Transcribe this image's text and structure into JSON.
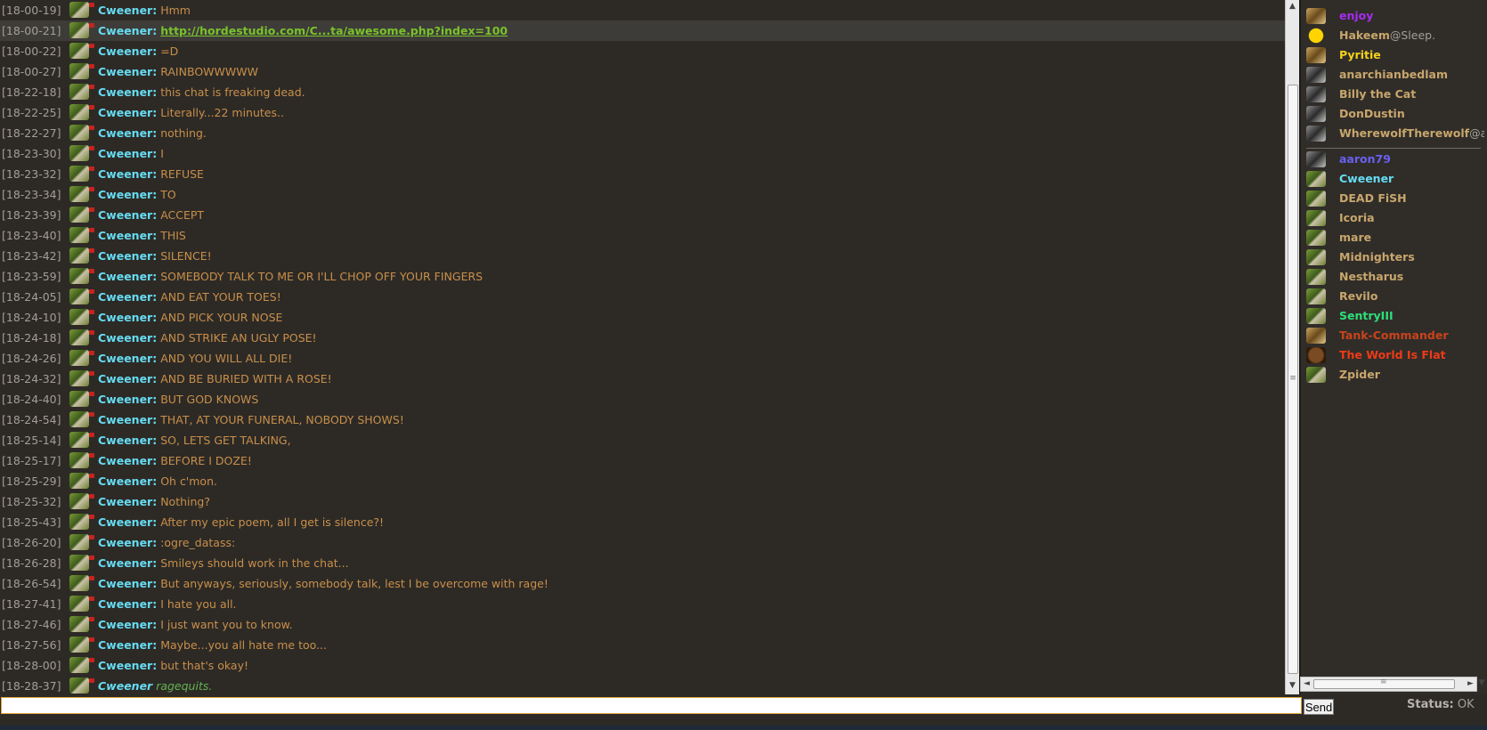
{
  "messages": [
    {
      "time": "[18-00-19]",
      "nick": "Cweener:",
      "text": "Hmm"
    },
    {
      "time": "[18-00-21]",
      "nick": "Cweener:",
      "link": "http://hordestudio.com/C...ta/awesome.php?index=100",
      "highlight": true
    },
    {
      "time": "[18-00-22]",
      "nick": "Cweener:",
      "text": "=D"
    },
    {
      "time": "[18-00-27]",
      "nick": "Cweener:",
      "text": "RAINBOWWWWW"
    },
    {
      "time": "[18-22-18]",
      "nick": "Cweener:",
      "text": "this chat is freaking dead."
    },
    {
      "time": "[18-22-25]",
      "nick": "Cweener:",
      "text": "Literally...22 minutes.."
    },
    {
      "time": "[18-22-27]",
      "nick": "Cweener:",
      "text": "nothing."
    },
    {
      "time": "[18-23-30]",
      "nick": "Cweener:",
      "text": "I"
    },
    {
      "time": "[18-23-32]",
      "nick": "Cweener:",
      "text": "REFUSE"
    },
    {
      "time": "[18-23-34]",
      "nick": "Cweener:",
      "text": "TO"
    },
    {
      "time": "[18-23-39]",
      "nick": "Cweener:",
      "text": "ACCEPT"
    },
    {
      "time": "[18-23-40]",
      "nick": "Cweener:",
      "text": "THIS"
    },
    {
      "time": "[18-23-42]",
      "nick": "Cweener:",
      "text": "SILENCE!"
    },
    {
      "time": "[18-23-59]",
      "nick": "Cweener:",
      "text": "SOMEBODY TALK TO ME OR I'LL CHOP OFF YOUR FINGERS"
    },
    {
      "time": "[18-24-05]",
      "nick": "Cweener:",
      "text": "AND EAT YOUR TOES!"
    },
    {
      "time": "[18-24-10]",
      "nick": "Cweener:",
      "text": "AND PICK YOUR NOSE"
    },
    {
      "time": "[18-24-18]",
      "nick": "Cweener:",
      "text": "AND STRIKE AN UGLY POSE!"
    },
    {
      "time": "[18-24-26]",
      "nick": "Cweener:",
      "text": "AND YOU WILL ALL DIE!"
    },
    {
      "time": "[18-24-32]",
      "nick": "Cweener:",
      "text": "AND BE BURIED WITH A ROSE!"
    },
    {
      "time": "[18-24-40]",
      "nick": "Cweener:",
      "text": "BUT GOD KNOWS"
    },
    {
      "time": "[18-24-54]",
      "nick": "Cweener:",
      "text": "THAT, AT YOUR FUNERAL, NOBODY SHOWS!"
    },
    {
      "time": "[18-25-14]",
      "nick": "Cweener:",
      "text": "SO, LETS GET TALKING,"
    },
    {
      "time": "[18-25-17]",
      "nick": "Cweener:",
      "text": "BEFORE I DOZE!"
    },
    {
      "time": "[18-25-29]",
      "nick": "Cweener:",
      "text": "Oh c'mon."
    },
    {
      "time": "[18-25-32]",
      "nick": "Cweener:",
      "text": "Nothing?"
    },
    {
      "time": "[18-25-43]",
      "nick": "Cweener:",
      "text": "After my epic poem, all I get is silence?!"
    },
    {
      "time": "[18-26-20]",
      "nick": "Cweener:",
      "text": ":ogre_datass:"
    },
    {
      "time": "[18-26-28]",
      "nick": "Cweener:",
      "text": "Smileys should work in the chat..."
    },
    {
      "time": "[18-26-54]",
      "nick": "Cweener:",
      "text": "But anyways, seriously, somebody talk, lest I be overcome with rage!"
    },
    {
      "time": "[18-27-41]",
      "nick": "Cweener:",
      "text": "I hate you all."
    },
    {
      "time": "[18-27-46]",
      "nick": "Cweener:",
      "text": "I just want you to know."
    },
    {
      "time": "[18-27-56]",
      "nick": "Cweener:",
      "text": "Maybe...you all hate me too..."
    },
    {
      "time": "[18-28-00]",
      "nick": "Cweener:",
      "text": "but that's okay!"
    },
    {
      "time": "[18-28-37]",
      "nick": "Cweener",
      "emote": "ragequits."
    }
  ],
  "users_top": [
    {
      "name": "enjoy",
      "color": "#a62cf0",
      "avatar": "gold"
    },
    {
      "name": "Hakeem",
      "suffix": "@Sleep.",
      "color": "#c8a66c",
      "avatar": "smile"
    },
    {
      "name": "Pyritie",
      "color": "#f2d21a",
      "avatar": "gold"
    },
    {
      "name": "anarchianbedlam",
      "color": "#c8a66c",
      "avatar": "alt"
    },
    {
      "name": "Billy the Cat",
      "color": "#c8a66c",
      "avatar": "alt"
    },
    {
      "name": "DonDustin",
      "color": "#c8a66c",
      "avatar": "alt"
    },
    {
      "name": "WherewolfTherewolf",
      "suffix": "@a",
      "color": "#c8a66c",
      "avatar": "alt"
    }
  ],
  "users_bottom": [
    {
      "name": "aaron79",
      "color": "#6a60f0",
      "avatar": "alt"
    },
    {
      "name": "Cweener",
      "color": "#66dcf2",
      "avatar": "orc"
    },
    {
      "name": "DEAD FiSH",
      "color": "#c8a66c",
      "avatar": "orc"
    },
    {
      "name": "Icoria",
      "color": "#c8a66c",
      "avatar": "orc"
    },
    {
      "name": "mare",
      "color": "#c8a66c",
      "avatar": "orc"
    },
    {
      "name": "Midnighters",
      "color": "#c8a66c",
      "avatar": "orc"
    },
    {
      "name": "Nestharus",
      "color": "#c8a66c",
      "avatar": "orc"
    },
    {
      "name": "Revilo",
      "color": "#c8a66c",
      "avatar": "orc"
    },
    {
      "name": "SentryIII",
      "color": "#2ee07a",
      "avatar": "orc"
    },
    {
      "name": "Tank-Commander",
      "color": "#c9431a",
      "avatar": "gold"
    },
    {
      "name": "The World Is Flat",
      "color": "#ef3a17",
      "avatar": "brown"
    },
    {
      "name": "Zpider",
      "color": "#c8a66c",
      "avatar": "orc"
    }
  ],
  "input": {
    "value": "",
    "placeholder": ""
  },
  "send_label": "Send",
  "status": {
    "label": "Status:",
    "value": "OK"
  },
  "icons": {
    "scroll_up": "▲",
    "scroll_down": "▼",
    "scroll_left": "◄",
    "scroll_right": "►",
    "grip": "≡"
  }
}
